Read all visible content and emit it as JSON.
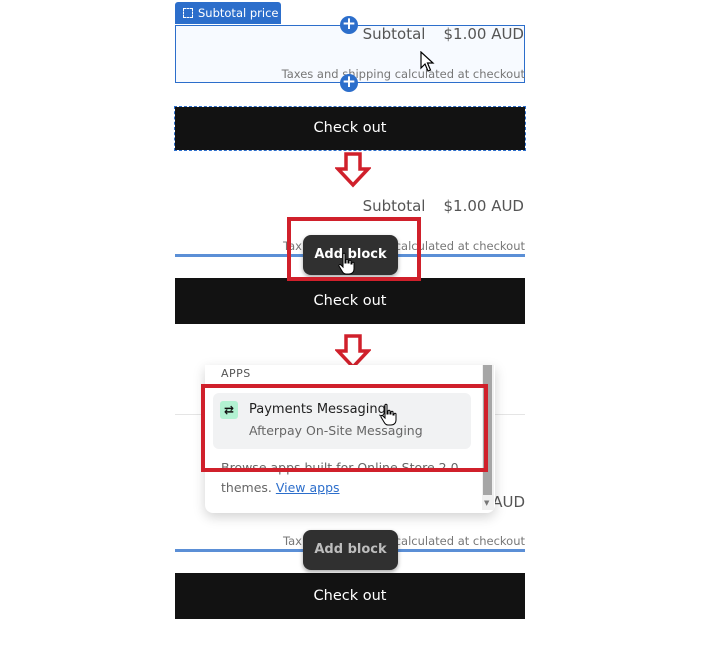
{
  "section1": {
    "tag_label": "Subtotal price",
    "subtotal_label": "Subtotal",
    "subtotal_value": "$1.00 AUD",
    "taxes_text": "Taxes and shipping calculated at checkout",
    "checkout_label": "Check out"
  },
  "section2": {
    "subtotal_label": "Subtotal",
    "subtotal_value": "$1.00 AUD",
    "taxes_prefix": "Tax",
    "taxes_suffix": "calculated at checkout",
    "add_block_label": "Add block",
    "checkout_label": "Check out"
  },
  "section3": {
    "popup": {
      "heading": "APPS",
      "app_name": "Payments Messaging",
      "app_desc": "Afterpay On-Site Messaging",
      "browse_text": "Browse apps built for Online Store 2.0 themes.",
      "view_apps_link": "View apps"
    },
    "value_fragment": "AUD",
    "taxes_prefix": "Tax",
    "taxes_suffix": "calculated at checkout",
    "add_block_label": "Add block",
    "checkout_label": "Check out"
  },
  "colors": {
    "accent_blue": "#2c6ecb",
    "highlight_red": "#d0202b",
    "checkout_black": "#121212",
    "app_icon_bg": "#b2f2d2"
  },
  "icons": [
    "square-dashed-icon",
    "plus-circle-icon",
    "arrow-down-icon",
    "link-app-icon",
    "pointer-cursor-icon",
    "hand-cursor-icon",
    "scroll-down-icon"
  ]
}
